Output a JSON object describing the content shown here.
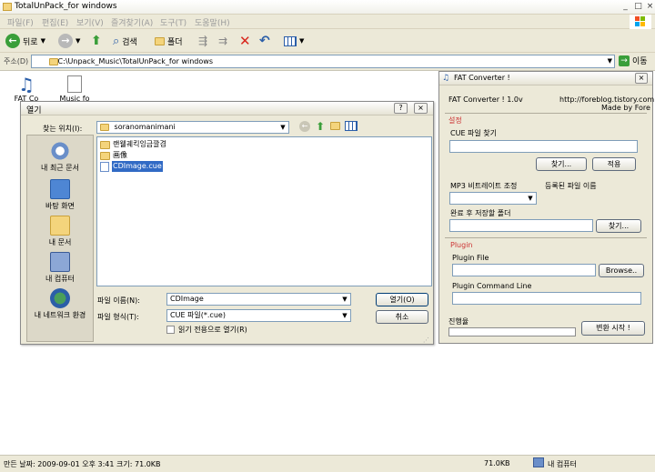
{
  "window": {
    "title": "TotalUnPack_for windows",
    "menus": [
      "파일(F)",
      "편집(E)",
      "보기(V)",
      "즐겨찾기(A)",
      "도구(T)",
      "도움말(H)"
    ]
  },
  "toolbar": {
    "back_label": "뒤로",
    "search_label": "검색",
    "folders_label": "폴더"
  },
  "address": {
    "label": "주소(D)",
    "value": "C:\\Unpack_Music\\TotalUnPack_for windows",
    "go_label": "이동"
  },
  "desktop_icons": [
    {
      "label": "FAT Co"
    },
    {
      "label": "Music fo"
    }
  ],
  "status": {
    "details": "만든 날짜: 2009-09-01 오후 3:41 크기: 71.0KB",
    "size": "71.0KB",
    "location": "내 컴퓨터"
  },
  "dialog": {
    "title": "열기",
    "lookin_label": "찾는 위치(I):",
    "lookin_value": "soranomanimani",
    "places": [
      {
        "label": "내 최근 문서",
        "icon": "recent-documents-icon"
      },
      {
        "label": "바탕 화면",
        "icon": "desktop-icon"
      },
      {
        "label": "내 문서",
        "icon": "my-documents-icon"
      },
      {
        "label": "내 컴퓨터",
        "icon": "my-computer-icon"
      },
      {
        "label": "내 네트워크 환경",
        "icon": "network-icon"
      }
    ],
    "files": [
      {
        "name": "랜웰궤킥잉금깔겸",
        "type": "folder"
      },
      {
        "name": "画像",
        "type": "folder"
      },
      {
        "name": "CDImage.cue",
        "type": "cue",
        "selected": true
      }
    ],
    "filename_label": "파일 이름(N):",
    "filename_value": "CDImage",
    "filetype_label": "파일 형식(T):",
    "filetype_value": "CUE 파일(*.cue)",
    "readonly_label": "읽기 전용으로 열기(R)",
    "open_label": "열기(O)",
    "cancel_label": "취소"
  },
  "fat": {
    "title": "FAT Converter !",
    "version": "FAT Converter ! 1.0v",
    "url": "http://foreblog.tistory.com",
    "madeby": "Made by Fore",
    "settings_label": "설정",
    "cue_label": "CUE 파일 찾기",
    "find_label": "찾기...",
    "apply_label": "적용",
    "bitrate_label": "MP3 비트레이트 조정",
    "regname_label": "등록된 파일 이름",
    "savefolder_label": "완료 후 저장할 폴더",
    "find2_label": "찾기...",
    "plugin_label": "Plugin",
    "pluginfile_label": "Plugin File",
    "browse_label": "Browse..",
    "plugincmd_label": "Plugin Command Line",
    "progress_label": "진행율",
    "progress": 0,
    "start_label": "변환 시작 !"
  },
  "colors": {
    "xp_face": "#ece9d8",
    "selection": "#316ac5",
    "section_red": "#cc3333"
  }
}
